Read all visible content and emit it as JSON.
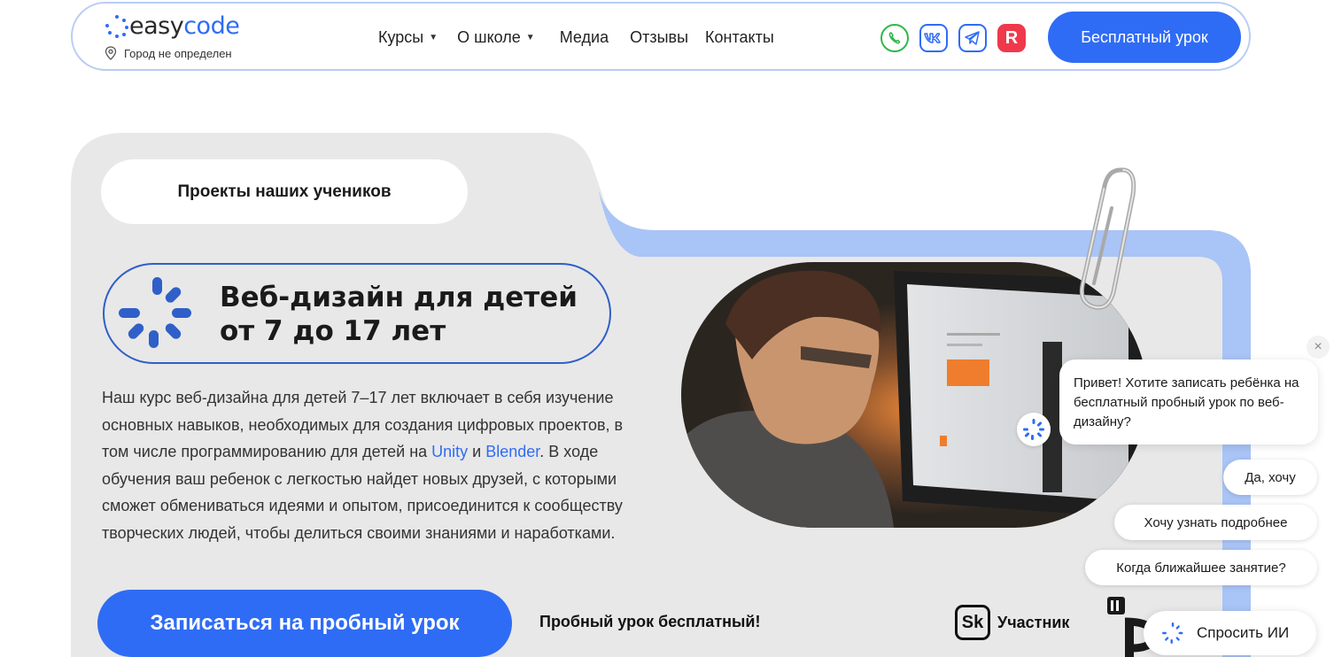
{
  "header": {
    "logo_prefix": "easy",
    "logo_accent": "code",
    "city": "Город не определен",
    "nav": [
      {
        "label": "Курсы",
        "dropdown": true
      },
      {
        "label": "О школе",
        "dropdown": true
      },
      {
        "label": "Медиа",
        "dropdown": false
      },
      {
        "label": "Отзывы",
        "dropdown": false
      },
      {
        "label": "Контакты",
        "dropdown": false
      }
    ],
    "socials": [
      "whatsapp-icon",
      "vk-icon",
      "telegram-icon",
      "rutube-icon"
    ],
    "rutube_letter": "R",
    "cta": "Бесплатный урок"
  },
  "hero": {
    "projects_label": "Проекты наших учеников",
    "title_line1": "Веб-дизайн для детей",
    "title_line2": "от 7 до 17 лет",
    "desc_part1": "Наш курс веб-дизайна для детей 7–17 лет включает в себя изучение основных навыков, необходимых для создания цифровых проектов, в том числе программированию для детей на ",
    "desc_link1": "Unity",
    "desc_part2": " и ",
    "desc_link2": "Blender",
    "desc_part3": ". В ходе обучения ваш ребенок с легкостью найдет новых друзей, с которыми сможет обмениваться идеями и опытом, присоединится к сообществу творческих людей, чтобы делиться своими знаниями и наработками.",
    "cta": "Записаться на пробный урок",
    "free_note": "Пробный урок бесплатный!",
    "sk_logo": "Sk",
    "sk_label": "Участник"
  },
  "chat": {
    "close": "×",
    "message": "Привет! Хотите записать ребёнка на бесплатный пробный урок по веб-дизайну?",
    "options": [
      "Да, хочу",
      "Хочу узнать подробнее",
      "Когда ближайшее занятие?"
    ],
    "ask_ai": "Спросить ИИ"
  },
  "colors": {
    "accent": "#2f6cf5",
    "card_bg": "#e8e8e8",
    "card_blue": "#a9c4f6",
    "header_border": "#b9cdf5"
  }
}
